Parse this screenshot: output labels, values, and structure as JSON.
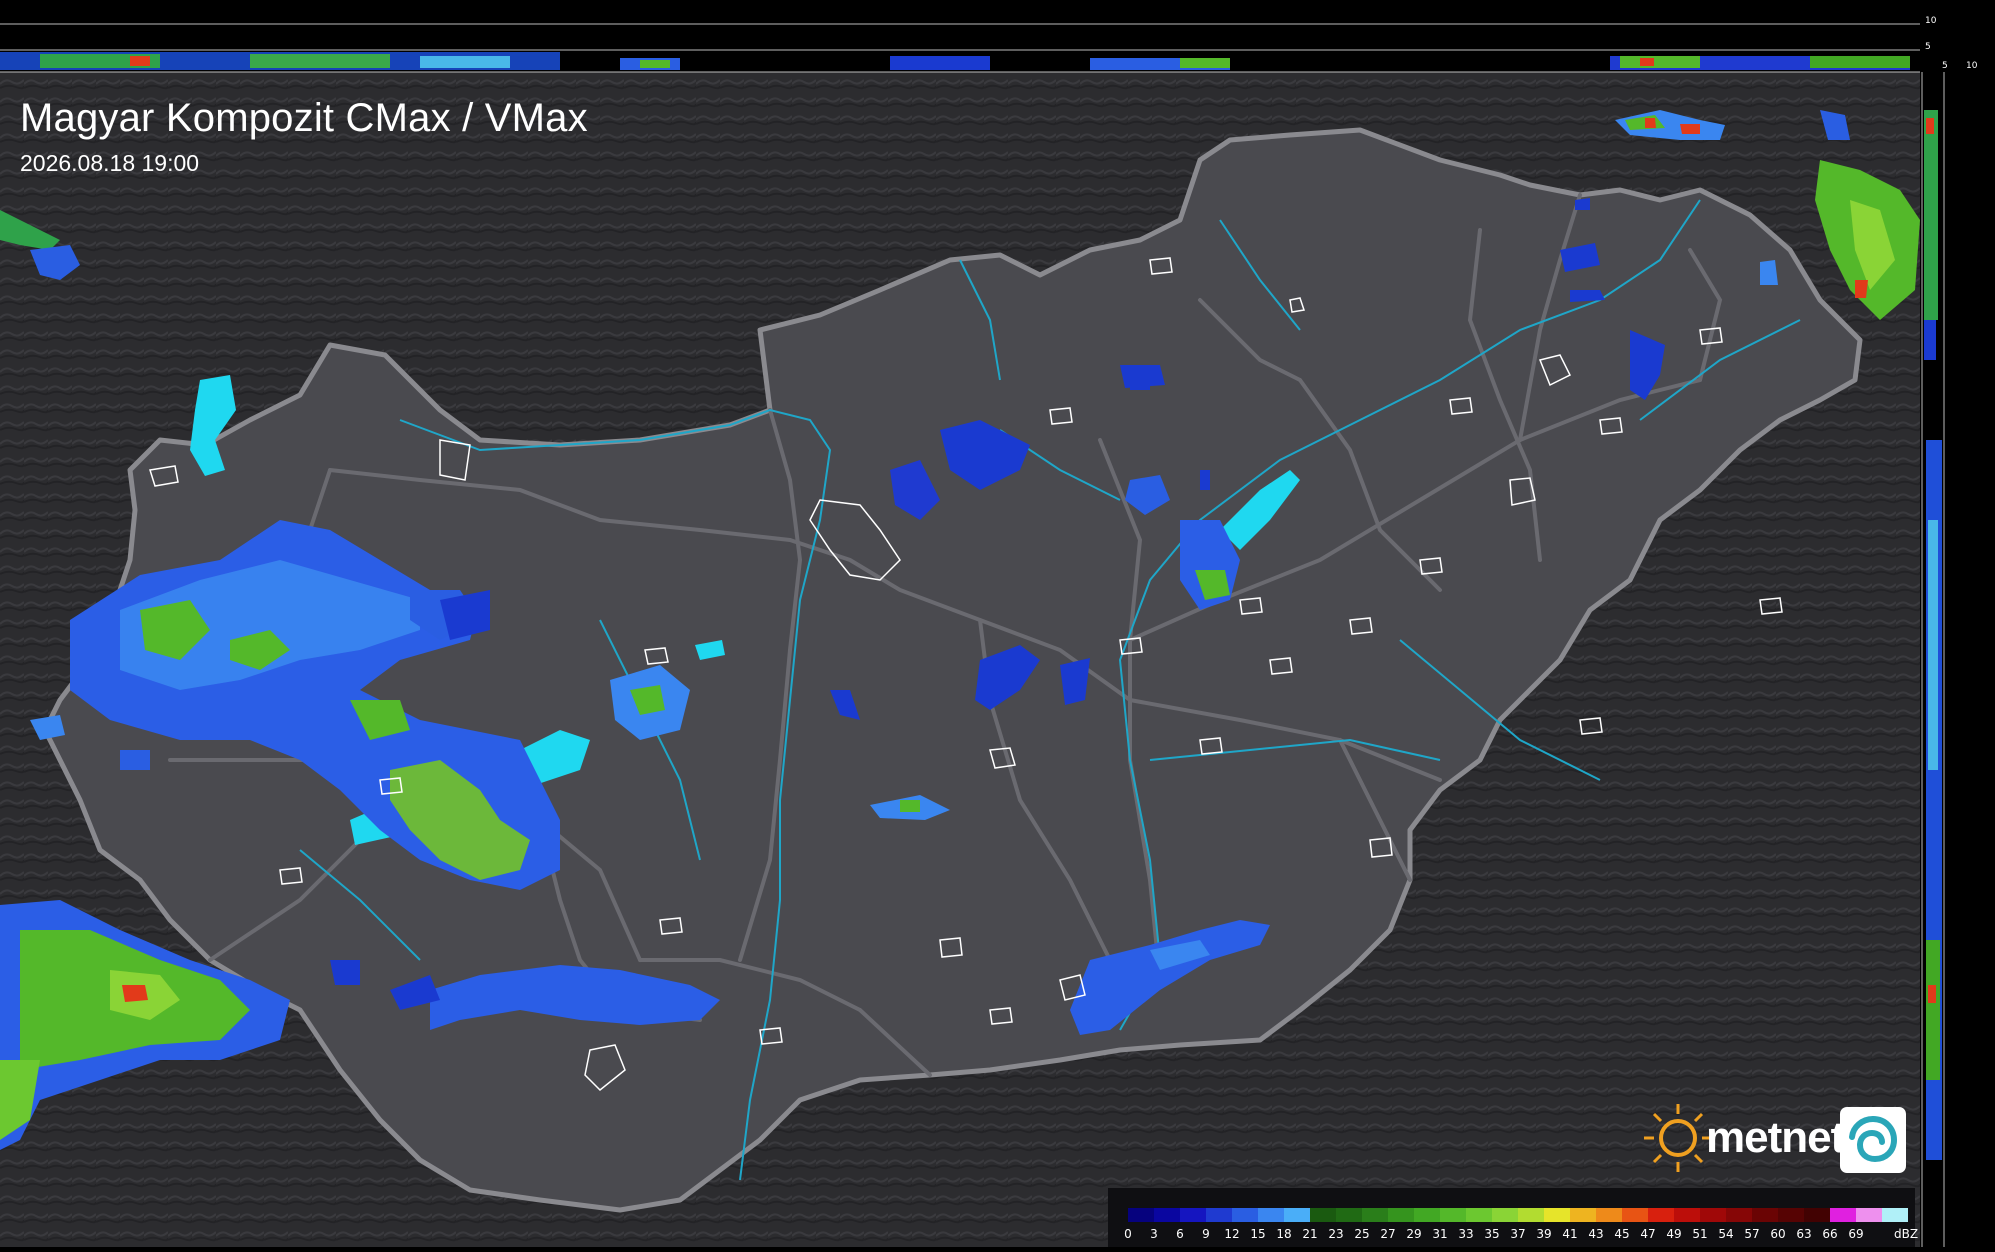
{
  "map": {
    "title": "Magyar Kompozit CMax / VMax",
    "timestamp": "2026.08.18 19:00"
  },
  "top_profile": {
    "axis_ticks": [
      "10",
      "5"
    ]
  },
  "side_profile": {
    "axis_ticks": [
      "5",
      "10"
    ]
  },
  "legend": {
    "unit": "dBZ",
    "entries": [
      {
        "label": "0",
        "color": "#06027e"
      },
      {
        "label": "3",
        "color": "#0a06a0"
      },
      {
        "label": "6",
        "color": "#1515c0"
      },
      {
        "label": "9",
        "color": "#1f3ad0"
      },
      {
        "label": "12",
        "color": "#2a5ee2"
      },
      {
        "label": "15",
        "color": "#3a86f0"
      },
      {
        "label": "18",
        "color": "#4aaef8"
      },
      {
        "label": "21",
        "color": "#1a5a10"
      },
      {
        "label": "23",
        "color": "#206a14"
      },
      {
        "label": "25",
        "color": "#2a7e1a"
      },
      {
        "label": "27",
        "color": "#35941e"
      },
      {
        "label": "29",
        "color": "#42a824"
      },
      {
        "label": "31",
        "color": "#54b82a"
      },
      {
        "label": "33",
        "color": "#6cc830"
      },
      {
        "label": "35",
        "color": "#8ad436"
      },
      {
        "label": "37",
        "color": "#b2dc30"
      },
      {
        "label": "39",
        "color": "#e6e42a"
      },
      {
        "label": "41",
        "color": "#eeb420"
      },
      {
        "label": "43",
        "color": "#ee8a1a"
      },
      {
        "label": "45",
        "color": "#e85414"
      },
      {
        "label": "47",
        "color": "#d8200e"
      },
      {
        "label": "49",
        "color": "#bc0e0a"
      },
      {
        "label": "51",
        "color": "#a00808"
      },
      {
        "label": "54",
        "color": "#860606"
      },
      {
        "label": "57",
        "color": "#6a0404"
      },
      {
        "label": "60",
        "color": "#560303"
      },
      {
        "label": "63",
        "color": "#420202"
      },
      {
        "label": "66",
        "color": "#e020e0"
      },
      {
        "label": "69",
        "color": "#ee90ee"
      },
      {
        "label": "",
        "color": "#b0f0f8"
      }
    ]
  },
  "brand": {
    "name": "metnet",
    "accent": "#f0a020"
  },
  "colors": {
    "background": "#2b2b2e",
    "country_fill": "#4a4a4f",
    "border": "#8a8a8f",
    "river": "#1fa6c8",
    "lake": "#1fd8f0",
    "city": "#ffffff"
  }
}
